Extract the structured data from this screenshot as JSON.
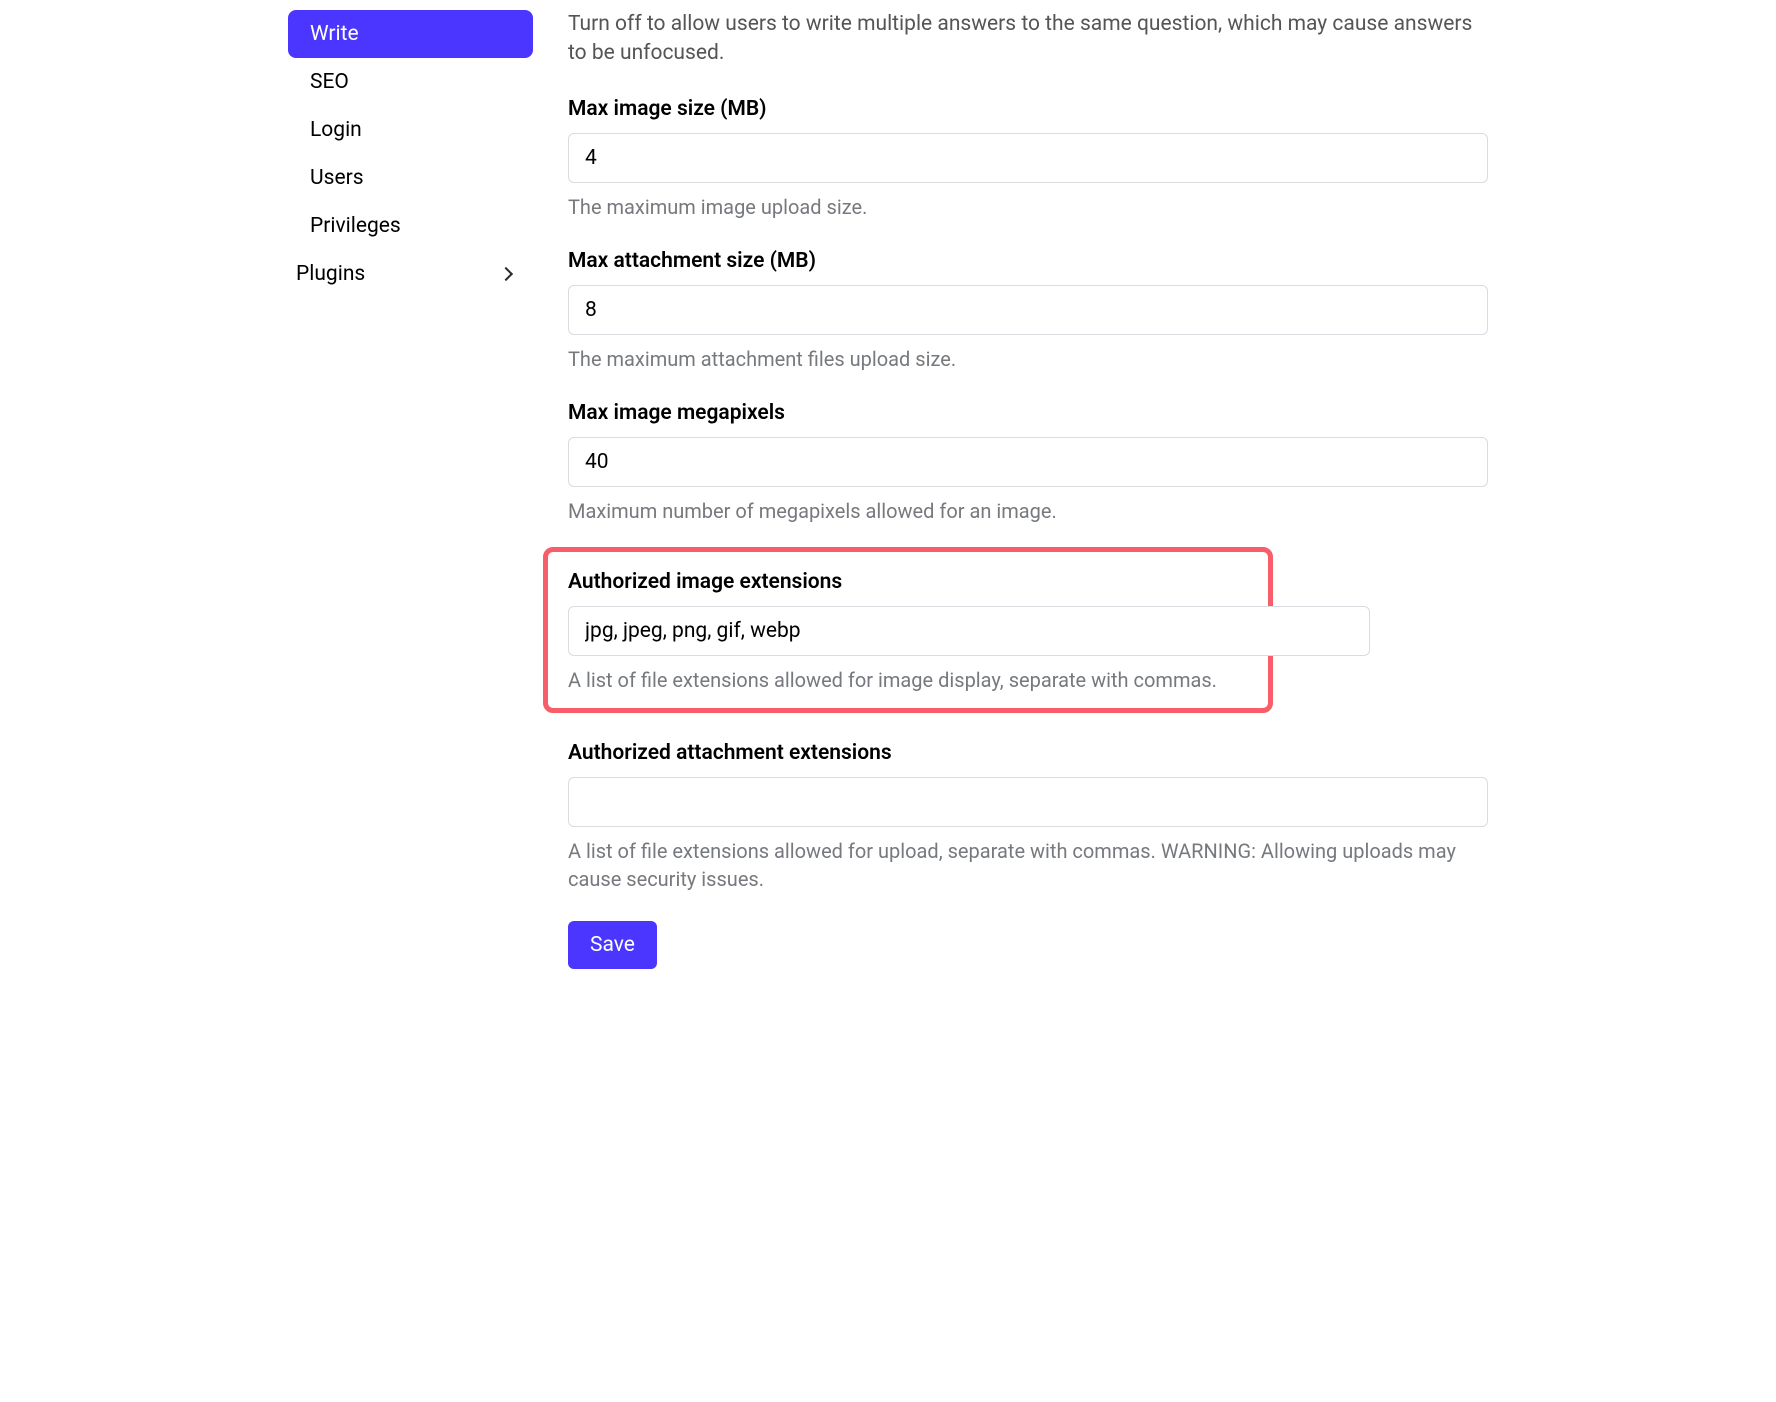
{
  "sidebar": {
    "items": [
      {
        "label": "Write",
        "active": true
      },
      {
        "label": "SEO",
        "active": false
      },
      {
        "label": "Login",
        "active": false
      },
      {
        "label": "Users",
        "active": false
      },
      {
        "label": "Privileges",
        "active": false
      }
    ],
    "plugins_label": "Plugins"
  },
  "main": {
    "top_description": "Turn off to allow users to write multiple answers to the same question, which may cause answers to be unfocused.",
    "fields": {
      "max_image_size": {
        "label": "Max image size (MB)",
        "value": "4",
        "help": "The maximum image upload size."
      },
      "max_attachment_size": {
        "label": "Max attachment size (MB)",
        "value": "8",
        "help": "The maximum attachment files upload size."
      },
      "max_image_megapixels": {
        "label": "Max image megapixels",
        "value": "40",
        "help": "Maximum number of megapixels allowed for an image."
      },
      "authorized_image_ext": {
        "label": "Authorized image extensions",
        "value": "jpg, jpeg, png, gif, webp",
        "help": "A list of file extensions allowed for image display, separate with commas."
      },
      "authorized_attachment_ext": {
        "label": "Authorized attachment extensions",
        "value": "",
        "help": "A list of file extensions allowed for upload, separate with commas. WARNING: Allowing uploads may cause security issues."
      }
    },
    "save_label": "Save"
  }
}
